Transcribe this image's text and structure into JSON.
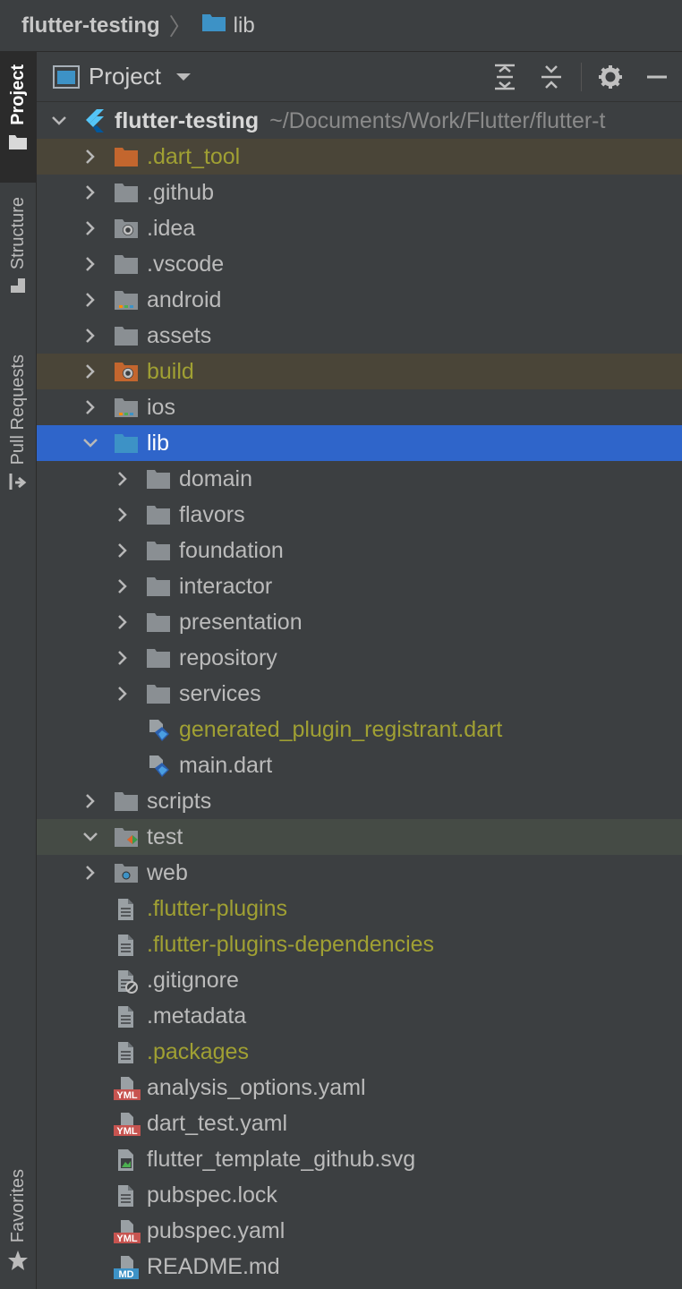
{
  "breadcrumb": {
    "root": "flutter-testing",
    "current": "lib"
  },
  "toolstrip": {
    "project": "Project",
    "structure": "Structure",
    "pull_requests": "Pull Requests",
    "favorites": "Favorites"
  },
  "panel": {
    "title": "Project"
  },
  "root": {
    "name": "flutter-testing",
    "path": "~/Documents/Work/Flutter/flutter-t"
  },
  "tree": [
    {
      "label": ".dart_tool",
      "icon": "folder-excluded-icon",
      "expandable": true,
      "expanded": false,
      "depth": 1,
      "style": "excluded"
    },
    {
      "label": ".github",
      "icon": "folder-icon",
      "expandable": true,
      "expanded": false,
      "depth": 1
    },
    {
      "label": ".idea",
      "icon": "folder-idea-icon",
      "expandable": true,
      "expanded": false,
      "depth": 1
    },
    {
      "label": ".vscode",
      "icon": "folder-icon",
      "expandable": true,
      "expanded": false,
      "depth": 1
    },
    {
      "label": "android",
      "icon": "folder-module-icon",
      "expandable": true,
      "expanded": false,
      "depth": 1
    },
    {
      "label": "assets",
      "icon": "folder-icon",
      "expandable": true,
      "expanded": false,
      "depth": 1
    },
    {
      "label": "build",
      "icon": "folder-excluded-gear-icon",
      "expandable": true,
      "expanded": false,
      "depth": 1,
      "style": "excluded"
    },
    {
      "label": "ios",
      "icon": "folder-module-icon",
      "expandable": true,
      "expanded": false,
      "depth": 1
    },
    {
      "label": "lib",
      "icon": "folder-source-icon",
      "expandable": true,
      "expanded": true,
      "depth": 1,
      "style": "selected"
    },
    {
      "label": "domain",
      "icon": "folder-icon",
      "expandable": true,
      "expanded": false,
      "depth": 2
    },
    {
      "label": "flavors",
      "icon": "folder-icon",
      "expandable": true,
      "expanded": false,
      "depth": 2
    },
    {
      "label": "foundation",
      "icon": "folder-icon",
      "expandable": true,
      "expanded": false,
      "depth": 2
    },
    {
      "label": "interactor",
      "icon": "folder-icon",
      "expandable": true,
      "expanded": false,
      "depth": 2
    },
    {
      "label": "presentation",
      "icon": "folder-icon",
      "expandable": true,
      "expanded": false,
      "depth": 2
    },
    {
      "label": "repository",
      "icon": "folder-icon",
      "expandable": true,
      "expanded": false,
      "depth": 2
    },
    {
      "label": "services",
      "icon": "folder-icon",
      "expandable": true,
      "expanded": false,
      "depth": 2
    },
    {
      "label": "generated_plugin_registrant.dart",
      "icon": "dart-file-icon",
      "expandable": false,
      "depth": 2,
      "style": "olive"
    },
    {
      "label": "main.dart",
      "icon": "dart-file-icon",
      "expandable": false,
      "depth": 2
    },
    {
      "label": "scripts",
      "icon": "folder-icon",
      "expandable": true,
      "expanded": false,
      "depth": 1
    },
    {
      "label": "test",
      "icon": "folder-test-icon",
      "expandable": true,
      "expanded": true,
      "depth": 1,
      "style": "test"
    },
    {
      "label": "web",
      "icon": "folder-web-icon",
      "expandable": true,
      "expanded": false,
      "depth": 1
    },
    {
      "label": ".flutter-plugins",
      "icon": "text-file-icon",
      "expandable": false,
      "depth": 1,
      "style": "olive"
    },
    {
      "label": ".flutter-plugins-dependencies",
      "icon": "text-file-icon",
      "expandable": false,
      "depth": 1,
      "style": "olive"
    },
    {
      "label": ".gitignore",
      "icon": "ignore-file-icon",
      "expandable": false,
      "depth": 1
    },
    {
      "label": ".metadata",
      "icon": "text-file-icon",
      "expandable": false,
      "depth": 1
    },
    {
      "label": ".packages",
      "icon": "text-file-icon",
      "expandable": false,
      "depth": 1,
      "style": "olive"
    },
    {
      "label": "analysis_options.yaml",
      "icon": "yaml-file-icon",
      "expandable": false,
      "depth": 1
    },
    {
      "label": "dart_test.yaml",
      "icon": "yaml-file-icon",
      "expandable": false,
      "depth": 1
    },
    {
      "label": "flutter_template_github.svg",
      "icon": "image-file-icon",
      "expandable": false,
      "depth": 1
    },
    {
      "label": "pubspec.lock",
      "icon": "text-file-icon",
      "expandable": false,
      "depth": 1
    },
    {
      "label": "pubspec.yaml",
      "icon": "yaml-file-icon",
      "expandable": false,
      "depth": 1
    },
    {
      "label": "README.md",
      "icon": "markdown-file-icon",
      "expandable": false,
      "depth": 1
    }
  ],
  "badges": {
    "yaml": "YML",
    "markdown": "MD"
  },
  "colors": {
    "background": "#3c3f41",
    "selection": "#2f65ca",
    "excluded_bg": "#4a4538",
    "excluded_folder": "#c3662e",
    "olive_text": "#a0a033",
    "folder": "#8a8f93",
    "source_folder": "#3d92c6",
    "test_bg": "#454b45"
  }
}
